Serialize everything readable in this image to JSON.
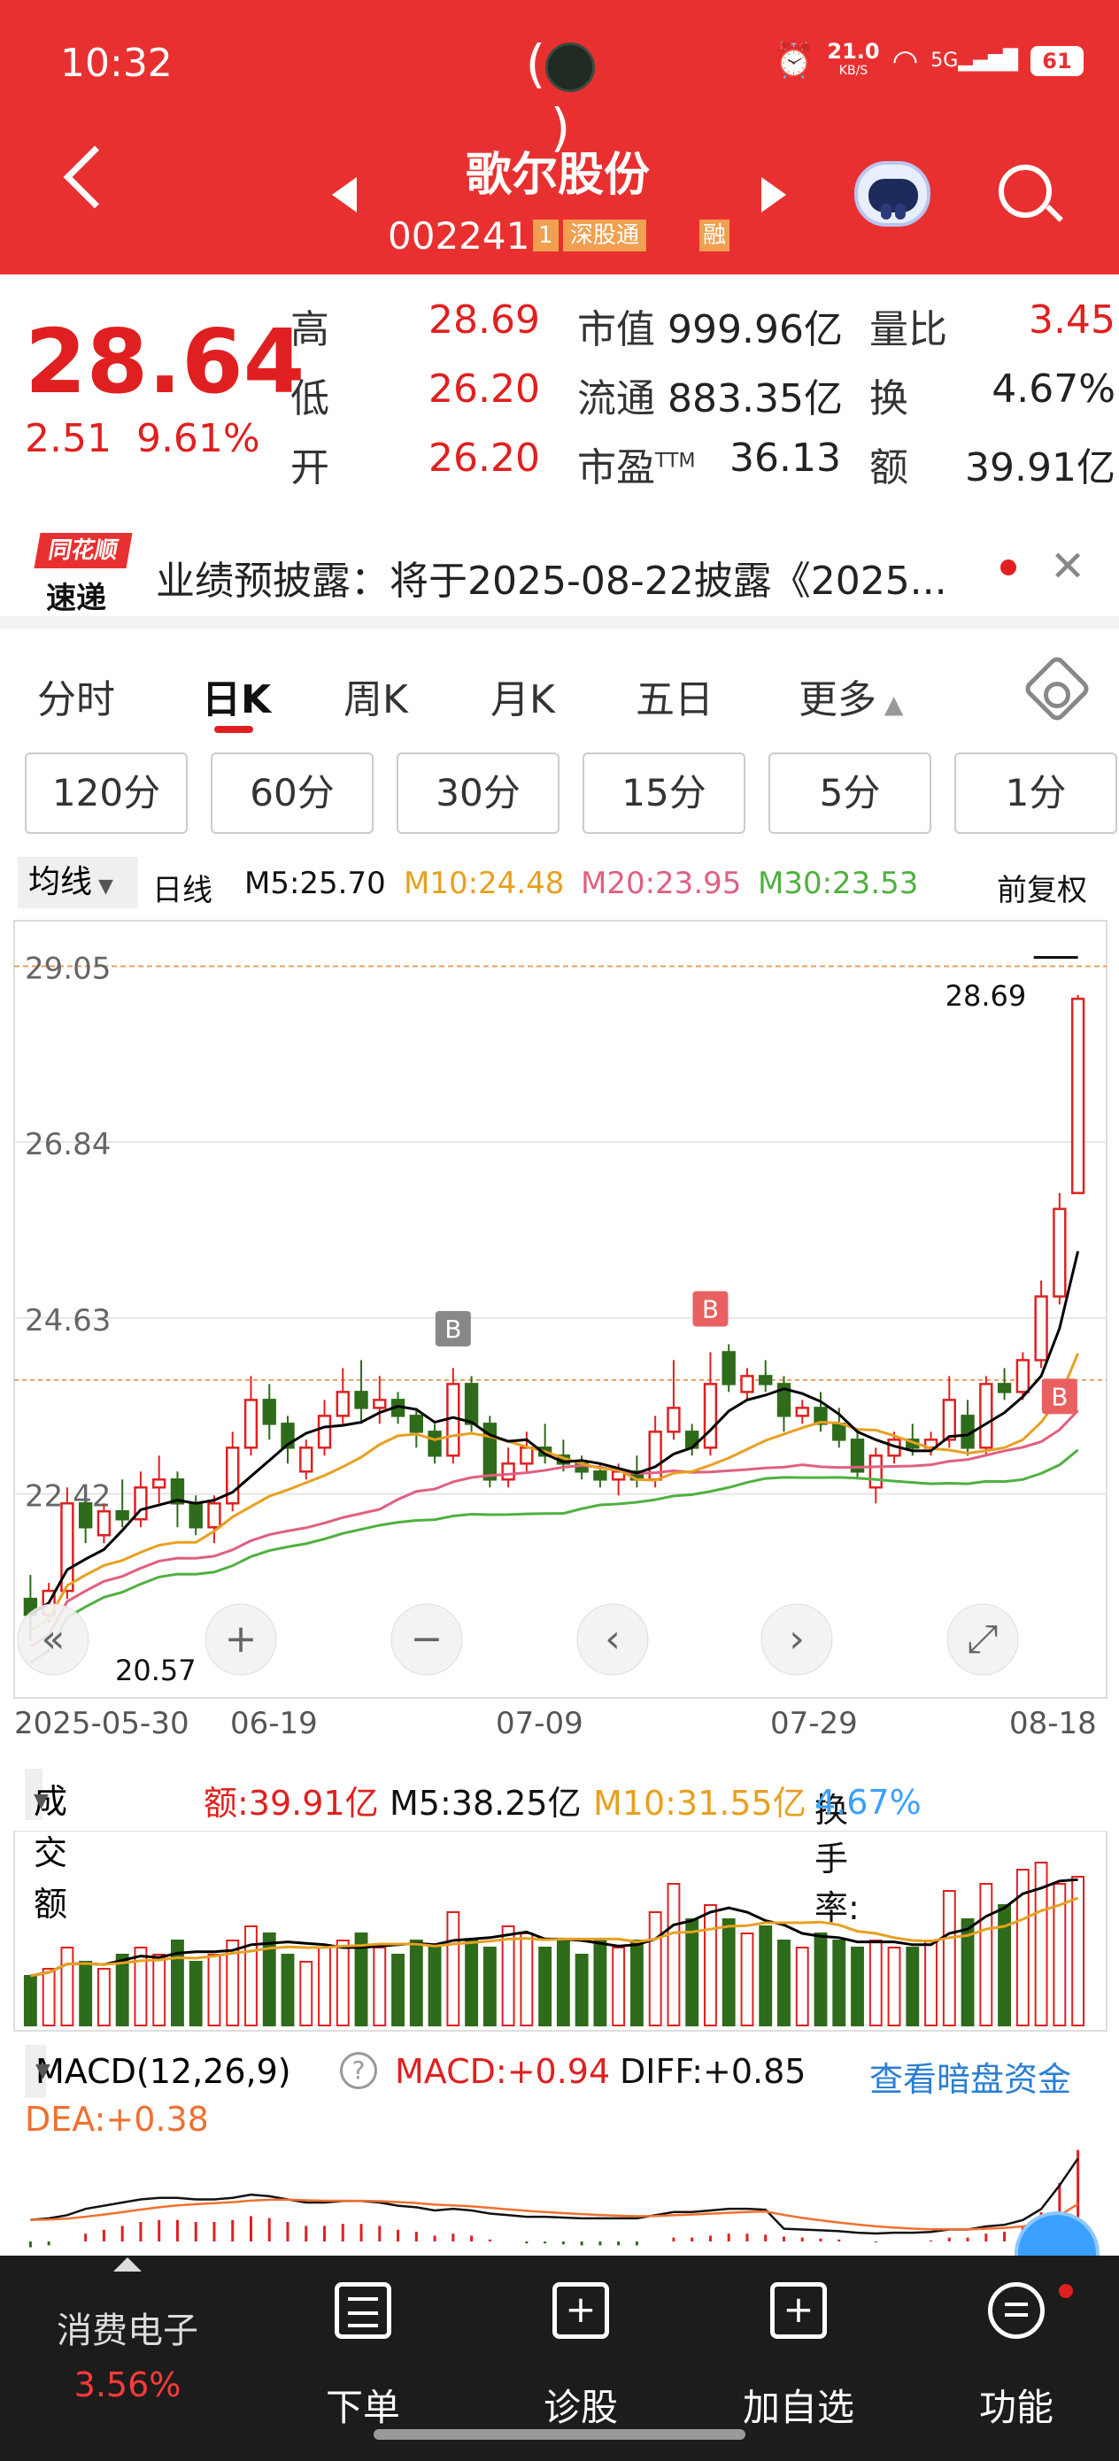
{
  "status_bar": {
    "time": "10:32",
    "net_speed": "21.0",
    "net_unit": "KB/S",
    "signal": "5G",
    "battery": "61"
  },
  "header": {
    "name": "歌尔股份",
    "code": "002241",
    "tag_num": "1",
    "tag_hk": "深股通",
    "tag_margin": "融"
  },
  "quote": {
    "price": "28.64",
    "change": "2.51",
    "change_pct": "9.61%",
    "high_label": "高",
    "high": "28.69",
    "low_label": "低",
    "low": "26.20",
    "open_label": "开",
    "open": "26.20",
    "mcap_label": "市值",
    "mcap": "999.96亿",
    "float_label": "流通",
    "float": "883.35亿",
    "pe_label": "市盈",
    "pe_sup": "TTM",
    "pe": "36.13",
    "vr_label": "量比",
    "vr": "3.45",
    "turn_label": "换",
    "turn": "4.67%",
    "amt_label": "额",
    "amt": "39.91亿"
  },
  "news": {
    "logo_top": "同花顺",
    "logo_bottom": "速递",
    "text": "业绩预披露：将于2025-08-22披露《2025..."
  },
  "tabs": [
    "分时",
    "日K",
    "周K",
    "月K",
    "五日",
    "更多"
  ],
  "minute_buttons": [
    "120分",
    "60分",
    "30分",
    "15分",
    "5分",
    "1分"
  ],
  "ma_legend": {
    "selector": "均线",
    "period": "日线",
    "m5": "M5:25.70",
    "m10": "M10:24.48",
    "m20": "M20:23.95",
    "m30": "M30:23.53",
    "adjust": "前复权"
  },
  "colors": {
    "up": "#e02020",
    "down": "#2e6b1a",
    "m5": "#000000",
    "m10": "#e8a020",
    "m20": "#e06080",
    "m30": "#50b040",
    "brand": "#e93030"
  },
  "chart_data": [
    {
      "type": "candlestick",
      "title": "",
      "y_ticks": [
        "29.05",
        "26.84",
        "24.63",
        "22.42"
      ],
      "ylim": [
        20.0,
        29.4
      ],
      "x_ticks": [
        "2025-05-30",
        "06-19",
        "07-09",
        "07-29",
        "08-18"
      ],
      "max_label": "28.69",
      "min_label": "20.57",
      "candles": [
        [
          21.1,
          21.4,
          20.57,
          20.9
        ],
        [
          20.9,
          21.3,
          20.8,
          21.2
        ],
        [
          21.2,
          22.5,
          21.1,
          22.3
        ],
        [
          22.3,
          22.3,
          21.8,
          22.0
        ],
        [
          21.9,
          22.3,
          21.8,
          22.2
        ],
        [
          22.2,
          22.6,
          22.0,
          22.1
        ],
        [
          22.1,
          22.7,
          22.0,
          22.5
        ],
        [
          22.5,
          22.9,
          22.3,
          22.6
        ],
        [
          22.6,
          22.7,
          22.0,
          22.3
        ],
        [
          22.3,
          22.4,
          21.9,
          22.0
        ],
        [
          22.0,
          22.4,
          21.8,
          22.3
        ],
        [
          22.3,
          23.2,
          22.2,
          23.0
        ],
        [
          23.0,
          23.9,
          22.9,
          23.6
        ],
        [
          23.6,
          23.8,
          23.1,
          23.3
        ],
        [
          23.3,
          23.4,
          22.8,
          23.0
        ],
        [
          22.7,
          23.1,
          22.6,
          23.0
        ],
        [
          23.0,
          23.6,
          22.9,
          23.4
        ],
        [
          23.4,
          24.0,
          23.3,
          23.7
        ],
        [
          23.7,
          24.1,
          23.3,
          23.5
        ],
        [
          23.5,
          23.9,
          23.3,
          23.6
        ],
        [
          23.6,
          23.7,
          23.3,
          23.4
        ],
        [
          23.4,
          23.5,
          23.0,
          23.2
        ],
        [
          23.2,
          23.3,
          22.8,
          22.9
        ],
        [
          22.9,
          24.0,
          22.8,
          23.8
        ],
        [
          23.8,
          23.9,
          23.2,
          23.3
        ],
        [
          23.3,
          23.4,
          22.5,
          22.6
        ],
        [
          22.6,
          23.0,
          22.5,
          22.8
        ],
        [
          22.8,
          23.2,
          22.7,
          23.0
        ],
        [
          23.0,
          23.3,
          22.8,
          22.9
        ],
        [
          22.9,
          23.1,
          22.7,
          22.8
        ],
        [
          22.8,
          22.9,
          22.6,
          22.7
        ],
        [
          22.7,
          22.8,
          22.5,
          22.6
        ],
        [
          22.6,
          22.8,
          22.4,
          22.7
        ],
        [
          22.7,
          22.9,
          22.5,
          22.6
        ],
        [
          22.6,
          23.4,
          22.5,
          23.2
        ],
        [
          23.2,
          24.1,
          23.1,
          23.5
        ],
        [
          23.2,
          23.3,
          22.9,
          23.0
        ],
        [
          23.0,
          24.2,
          22.9,
          23.8
        ],
        [
          24.2,
          24.3,
          23.7,
          23.8
        ],
        [
          23.7,
          24.0,
          23.6,
          23.9
        ],
        [
          23.9,
          24.1,
          23.7,
          23.8
        ],
        [
          23.8,
          23.9,
          23.2,
          23.4
        ],
        [
          23.4,
          23.6,
          23.3,
          23.5
        ],
        [
          23.5,
          23.7,
          23.2,
          23.3
        ],
        [
          23.3,
          23.5,
          23.0,
          23.1
        ],
        [
          23.1,
          23.2,
          22.6,
          22.7
        ],
        [
          22.5,
          23.0,
          22.3,
          22.9
        ],
        [
          22.9,
          23.2,
          22.8,
          23.1
        ],
        [
          23.1,
          23.3,
          22.9,
          23.0
        ],
        [
          23.0,
          23.2,
          22.9,
          23.1
        ],
        [
          23.1,
          23.9,
          23.0,
          23.6
        ],
        [
          23.4,
          23.6,
          22.9,
          23.0
        ],
        [
          23.0,
          23.9,
          22.9,
          23.8
        ],
        [
          23.8,
          24.0,
          23.6,
          23.7
        ],
        [
          23.7,
          24.2,
          23.6,
          24.1
        ],
        [
          24.1,
          25.1,
          24.0,
          24.9
        ],
        [
          24.9,
          26.2,
          24.8,
          26.0
        ],
        [
          26.2,
          28.69,
          26.2,
          28.64
        ]
      ]
    },
    {
      "type": "bar",
      "title": "",
      "series_name": "成交额",
      "values": [
        14,
        16,
        22,
        18,
        16,
        20,
        22,
        20,
        24,
        18,
        20,
        24,
        28,
        26,
        20,
        18,
        22,
        24,
        26,
        22,
        20,
        24,
        22,
        32,
        24,
        22,
        28,
        26,
        22,
        24,
        20,
        24,
        22,
        24,
        32,
        40,
        30,
        34,
        30,
        26,
        28,
        24,
        22,
        26,
        24,
        22,
        24,
        22,
        22,
        24,
        38,
        30,
        40,
        34,
        44,
        46,
        40,
        42
      ]
    },
    {
      "type": "bar",
      "title": "",
      "series_name": "MACD",
      "values": [
        -0.06,
        -0.04,
        0.0,
        0.08,
        0.12,
        0.16,
        0.2,
        0.22,
        0.22,
        0.2,
        0.2,
        0.22,
        0.26,
        0.24,
        0.2,
        0.16,
        0.16,
        0.18,
        0.18,
        0.16,
        0.12,
        0.1,
        0.06,
        0.08,
        0.06,
        0.02,
        0.0,
        -0.02,
        -0.02,
        -0.03,
        -0.04,
        -0.04,
        -0.04,
        -0.04,
        0.0,
        0.04,
        0.04,
        0.06,
        0.08,
        0.08,
        0.07,
        0.05,
        0.04,
        0.03,
        0.02,
        0.0,
        -0.01,
        0.0,
        0.0,
        0.01,
        0.04,
        0.04,
        0.08,
        0.1,
        0.16,
        0.3,
        0.6,
        0.94
      ]
    }
  ],
  "volume_legend": {
    "selector": "成交额",
    "amount": "额:39.91亿",
    "m5": "M5:38.25亿",
    "m10": "M10:31.55亿",
    "turn_label": "换手率:",
    "turn": "4.67%"
  },
  "macd_legend": {
    "selector": "MACD(12,26,9)",
    "macd": "MACD:+0.94",
    "diff": "DIFF:+0.85",
    "dea": "DEA:+0.38",
    "link": "查看暗盘资金"
  },
  "bottom_nav": {
    "sector": "消费电子",
    "sector_pct": "3.56%",
    "order": "下单",
    "diagnose": "诊股",
    "add_watch": "加自选",
    "function": "功能"
  }
}
